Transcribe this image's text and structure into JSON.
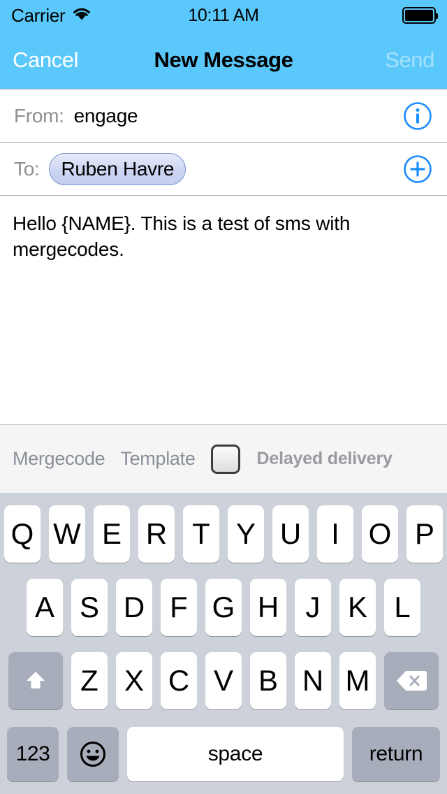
{
  "status_bar": {
    "carrier": "Carrier",
    "wifi_icon": "wifi-icon",
    "time": "10:11 AM",
    "battery_icon": "battery-full-icon",
    "battery_level": 100
  },
  "nav_bar": {
    "cancel_label": "Cancel",
    "title": "New Message",
    "send_label": "Send",
    "send_enabled": false,
    "background_color": "#5ac8fa",
    "title_color": "#000000",
    "cancel_color": "#ffffff",
    "send_disabled_color": "#a5e1fb"
  },
  "compose": {
    "from": {
      "label": "From:",
      "value": "engage",
      "action_icon": "info-circle-icon"
    },
    "to": {
      "label": "To:",
      "recipients": [
        "Ruben Havre"
      ],
      "action_icon": "plus-circle-icon"
    },
    "body_text": "Hello {NAME}. This is a test of sms with mergecodes.",
    "accent_color": "#007aff"
  },
  "accessory_bar": {
    "mergecode_label": "Mergecode",
    "template_label": "Template",
    "delayed_delivery_label": "Delayed delivery",
    "delayed_delivery_checked": false,
    "checkbox_icon": "checkbox-unchecked-icon"
  },
  "keyboard": {
    "row1": [
      "Q",
      "W",
      "E",
      "R",
      "T",
      "Y",
      "U",
      "I",
      "O",
      "P"
    ],
    "row2": [
      "A",
      "S",
      "D",
      "F",
      "G",
      "H",
      "J",
      "K",
      "L"
    ],
    "row3": [
      "Z",
      "X",
      "C",
      "V",
      "B",
      "N",
      "M"
    ],
    "shift_icon": "shift-arrow-icon",
    "backspace_icon": "backspace-delete-icon",
    "numbers_label": "123",
    "emoji_icon": "emoji-smiley-icon",
    "space_label": "space",
    "return_label": "return",
    "background_color": "#cdd1d9",
    "key_color": "#ffffff",
    "function_key_color": "#a7adba"
  }
}
